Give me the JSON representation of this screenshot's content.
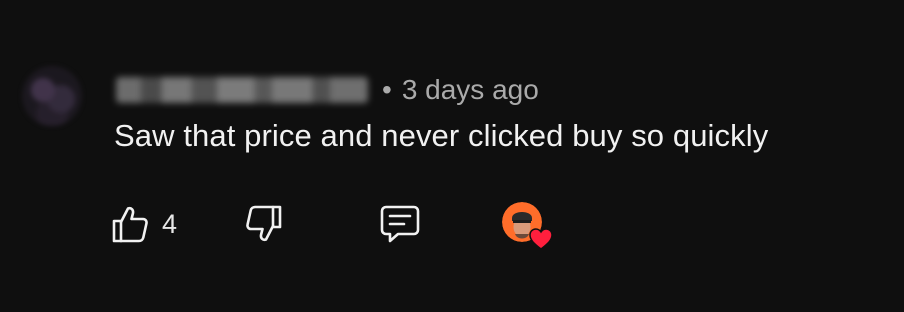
{
  "comment": {
    "username": "@redacted_user3711",
    "separator": "•",
    "timestamp": "3 days ago",
    "text": "Saw that price and never clicked buy so quickly",
    "likes": "4"
  },
  "icons": {
    "like": "thumbs-up-icon",
    "dislike": "thumbs-down-icon",
    "reply": "reply-comment-icon",
    "creator_heart": "creator-heart-icon"
  },
  "colors": {
    "background": "#0f0f0f",
    "text_primary": "#f1f1f1",
    "text_secondary": "#aaaaaa",
    "heart": "#ff1f3d",
    "creator_avatar_bg": "#ff6d2a"
  }
}
